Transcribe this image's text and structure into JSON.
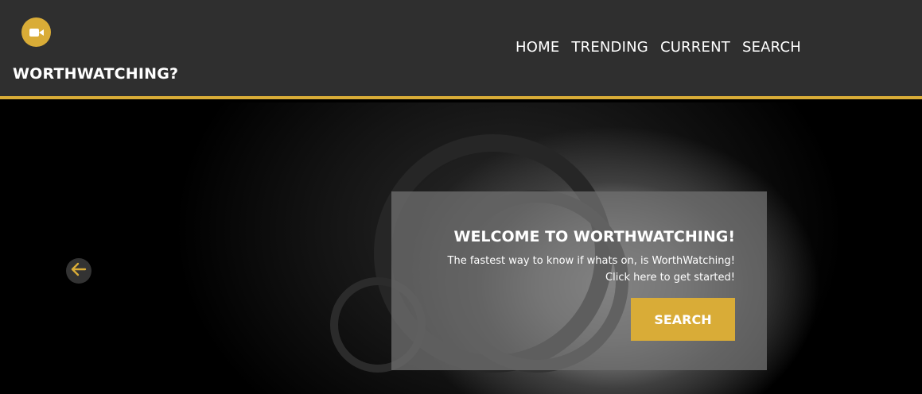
{
  "brand": {
    "logo_icon": "video-camera-icon",
    "name": "WORTHWATCHING?",
    "accent_color": "#d9ac37"
  },
  "nav": {
    "items": [
      {
        "label": "HOME"
      },
      {
        "label": "TRENDING"
      },
      {
        "label": "CURRENT"
      },
      {
        "label": "SEARCH"
      }
    ]
  },
  "hero": {
    "title": "WELCOME TO WORTHWATCHING!",
    "line1": "The fastest way to know if whats on, is WorthWatching!",
    "line2": "Click here to get started!",
    "button_label": "SEARCH",
    "prev_icon": "arrow-left-icon"
  }
}
